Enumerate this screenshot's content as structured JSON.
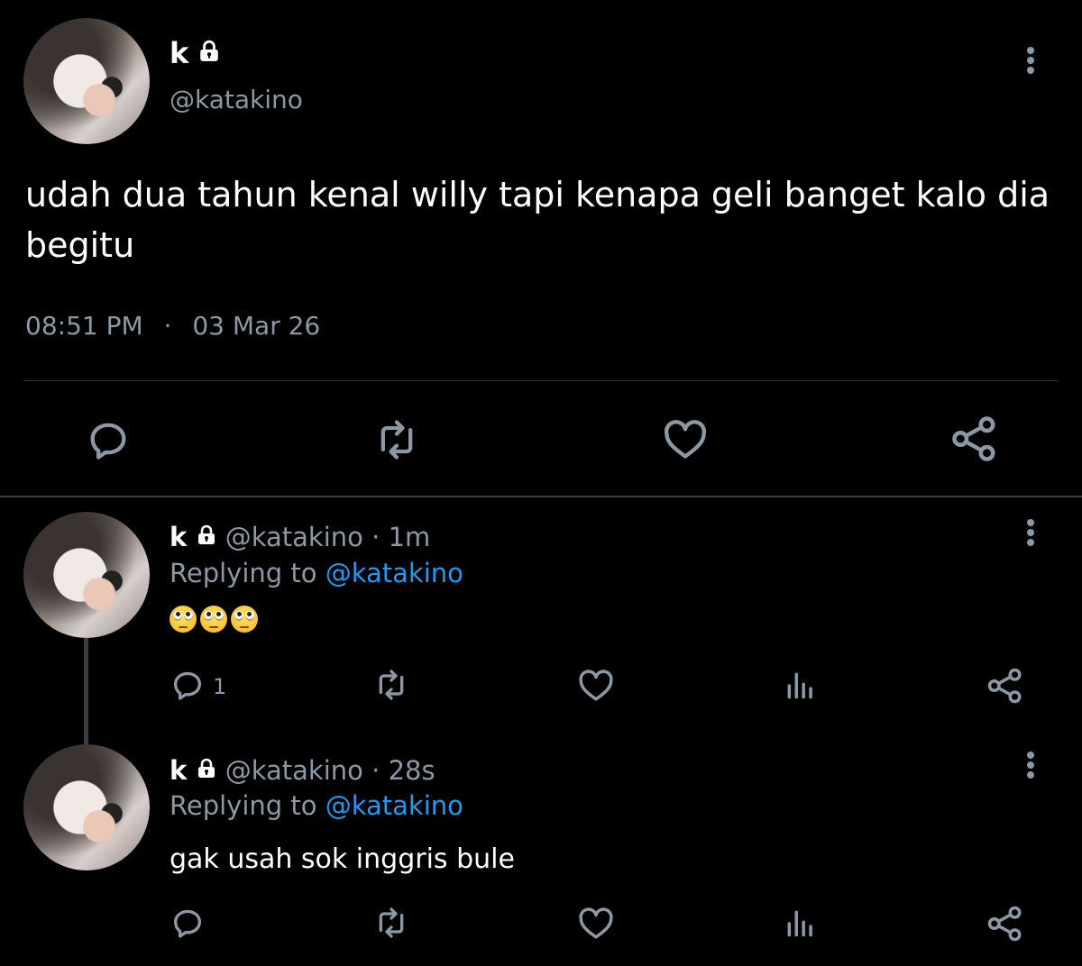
{
  "main_tweet": {
    "display_name": "k",
    "handle": "@katakino",
    "text": "udah dua tahun kenal willy tapi kenapa geli banget kalo dia begitu",
    "time": "08:51 PM",
    "separator": "·",
    "date": "03 Mar 26",
    "actions": [
      "reply-icon",
      "retweet-icon",
      "like-icon",
      "share-icon"
    ]
  },
  "replies": [
    {
      "display_name": "k",
      "handle": "@katakino",
      "dot": "·",
      "age": "1m",
      "replying_prefix": "Replying to",
      "replying_to": "@katakino",
      "text": "🙄🙄🙄",
      "reply_count": "1",
      "actions": [
        "reply-icon",
        "retweet-icon",
        "like-icon",
        "analytics-icon",
        "share-icon"
      ]
    },
    {
      "display_name": "k",
      "handle": "@katakino",
      "dot": "·",
      "age": "28s",
      "replying_prefix": "Replying to",
      "replying_to": "@katakino",
      "text": "gak usah sok inggris bule",
      "reply_count": "",
      "actions": [
        "reply-icon",
        "retweet-icon",
        "like-icon",
        "analytics-icon",
        "share-icon"
      ]
    }
  ],
  "colors": {
    "background": "#000000",
    "muted": "#8b98a5",
    "link": "#1d9bf0",
    "divider": "#2f3336"
  }
}
